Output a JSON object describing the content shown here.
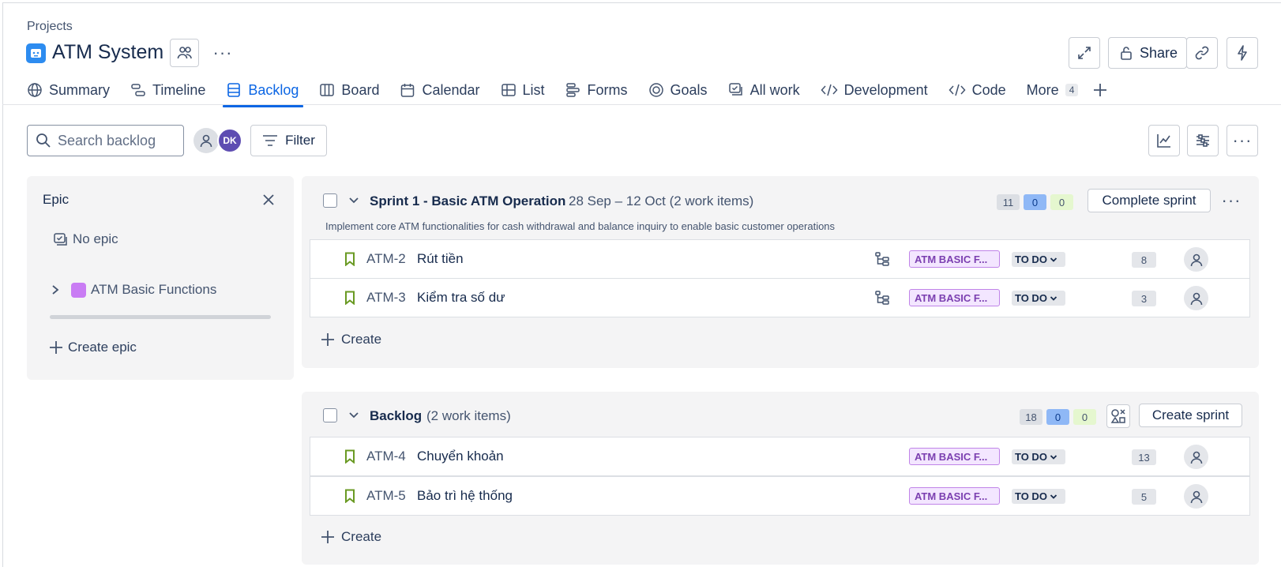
{
  "breadcrumb": "Projects",
  "project": {
    "title": "ATM System"
  },
  "header_buttons": {
    "share_label": "Share"
  },
  "nav": {
    "tabs": [
      {
        "label": "Summary",
        "icon": "globe-icon"
      },
      {
        "label": "Timeline",
        "icon": "timeline-icon"
      },
      {
        "label": "Backlog",
        "icon": "backlog-icon",
        "active": true
      },
      {
        "label": "Board",
        "icon": "board-icon"
      },
      {
        "label": "Calendar",
        "icon": "calendar-icon"
      },
      {
        "label": "List",
        "icon": "list-icon"
      },
      {
        "label": "Forms",
        "icon": "forms-icon"
      },
      {
        "label": "Goals",
        "icon": "goals-icon"
      },
      {
        "label": "All work",
        "icon": "all-work-icon"
      },
      {
        "label": "Development",
        "icon": "development-icon"
      },
      {
        "label": "Code",
        "icon": "code-icon"
      }
    ],
    "more_label": "More",
    "more_count": "4"
  },
  "toolbar": {
    "search_placeholder": "Search backlog",
    "avatar_initials": "DK",
    "filter_label": "Filter"
  },
  "epic_panel": {
    "title": "Epic",
    "no_epic_label": "No epic",
    "epic_name": "ATM Basic Functions",
    "epic_color": "#c97cf4",
    "create_epic_label": "Create epic"
  },
  "sprint": {
    "name": "Sprint 1 - Basic ATM Operation",
    "dates": "28 Sep – 12 Oct (2 work items)",
    "goal": "Implement core ATM functionalities for cash withdrawal and balance inquiry to enable basic customer operations",
    "counts": {
      "todo": "11",
      "in_progress": "0",
      "done": "0"
    },
    "complete_label": "Complete sprint",
    "create_label": "Create",
    "items": [
      {
        "key": "ATM-2",
        "summary": "Rút tiền",
        "epic": "ATM BASIC F...",
        "status": "TO DO",
        "points": "8"
      },
      {
        "key": "ATM-3",
        "summary": "Kiểm tra số dư",
        "epic": "ATM BASIC F...",
        "status": "TO DO",
        "points": "3"
      }
    ]
  },
  "backlog": {
    "name": "Backlog",
    "count_label": "(2 work items)",
    "counts": {
      "todo": "18",
      "in_progress": "0",
      "done": "0"
    },
    "create_sprint_label": "Create sprint",
    "create_label": "Create",
    "items": [
      {
        "key": "ATM-4",
        "summary": "Chuyển khoản",
        "epic": "ATM BASIC F...",
        "status": "TO DO",
        "points": "13"
      },
      {
        "key": "ATM-5",
        "summary": "Bảo trì hệ thống",
        "epic": "ATM BASIC F...",
        "status": "TO DO",
        "points": "5"
      }
    ]
  },
  "colors": {
    "accent": "#0c66e4",
    "epic_tag_bg": "#f3e6ff",
    "epic_tag_text": "#7b3fb0",
    "story_green": "#6a9a23"
  }
}
